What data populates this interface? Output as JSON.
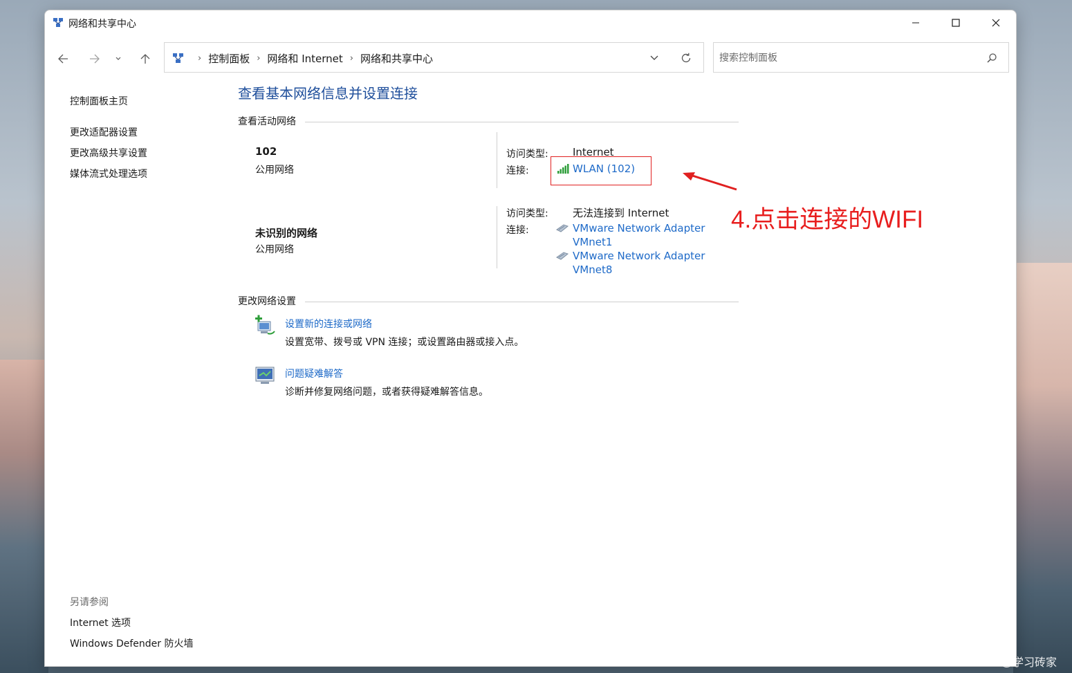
{
  "window": {
    "title": "网络和共享中心"
  },
  "address": {
    "crumbs": [
      "控制面板",
      "网络和 Internet",
      "网络和共享中心"
    ]
  },
  "search": {
    "placeholder": "搜索控制面板"
  },
  "sidebar": {
    "items": [
      "控制面板主页",
      "更改适配器设置",
      "更改高级共享设置",
      "媒体流式处理选项"
    ],
    "see_also_label": "另请参阅",
    "see_also_items": [
      "Internet 选项",
      "Windows Defender 防火墙"
    ]
  },
  "main": {
    "title": "查看基本网络信息并设置连接",
    "active_header": "查看活动网络",
    "access_label": "访问类型:",
    "connection_label": "连接:",
    "networks": [
      {
        "name": "102",
        "type": "公用网络",
        "access": "Internet",
        "connections": [
          "WLAN (102)"
        ]
      },
      {
        "name": "未识别的网络",
        "type": "公用网络",
        "access": "无法连接到 Internet",
        "connections": [
          "VMware Network Adapter",
          "VMnet1",
          "VMware Network Adapter",
          "VMnet8"
        ]
      }
    ],
    "change_header": "更改网络设置",
    "tasks": [
      {
        "link": "设置新的连接或网络",
        "desc": "设置宽带、拨号或 VPN 连接；或设置路由器或接入点。",
        "icon": "new-connection-icon"
      },
      {
        "link": "问题疑难解答",
        "desc": "诊断并修复网络问题，或者获得疑难解答信息。",
        "icon": "troubleshoot-icon"
      }
    ]
  },
  "annotation": {
    "text": "4.点击连接的WIFI",
    "color": "#e81e1e"
  },
  "watermark": "CSDN @学习砖家",
  "colors": {
    "link": "#1e6ac8",
    "title": "#1e4e9b"
  }
}
